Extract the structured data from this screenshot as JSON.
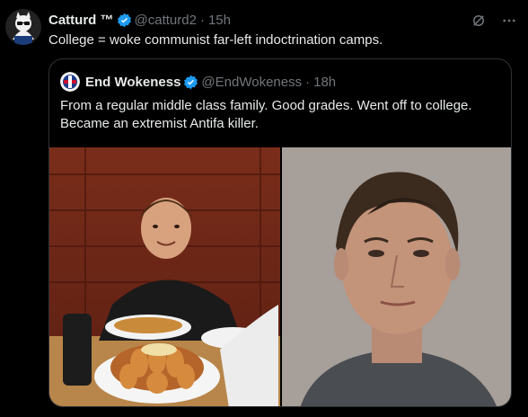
{
  "tweet": {
    "author_name": "Catturd ™",
    "handle": "@catturd2",
    "time": "15h",
    "text": "College = woke communist far-left indoctrination camps."
  },
  "quoted": {
    "author_name": "End Wokeness",
    "handle": "@EndWokeness",
    "time": "18h",
    "text": "From a regular middle class family. Good grades. Went off to college. Became an extremist Antifa killer."
  },
  "colors": {
    "background": "#000000",
    "verified_badge": "#1d9bf0",
    "muted_text": "#71767b",
    "border": "#2f3336"
  },
  "icons": {
    "verified": "verified-badge-icon",
    "grok": "grok-icon",
    "more": "more-options-icon"
  }
}
